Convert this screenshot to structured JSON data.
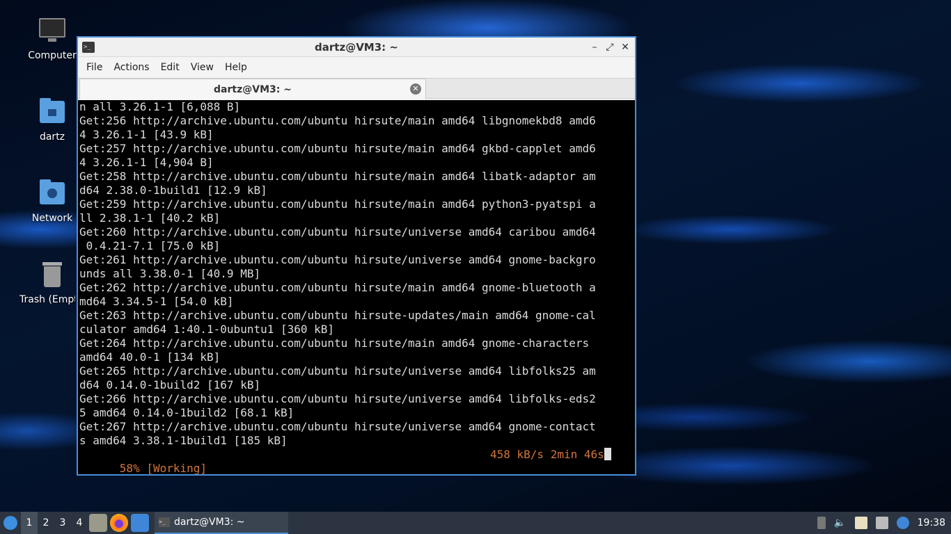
{
  "desktop": {
    "icons": [
      {
        "label": "Computer"
      },
      {
        "label": "dartz"
      },
      {
        "label": "Network"
      },
      {
        "label": "Trash (Empty)"
      }
    ]
  },
  "window": {
    "title": "dartz@VM3: ~",
    "menu": [
      "File",
      "Actions",
      "Edit",
      "View",
      "Help"
    ],
    "tab_label": "dartz@VM3: ~"
  },
  "terminal": {
    "lines": [
      "n all 3.26.1-1 [6,088 B]",
      "Get:256 http://archive.ubuntu.com/ubuntu hirsute/main amd64 libgnomekbd8 amd6",
      "4 3.26.1-1 [43.9 kB]",
      "Get:257 http://archive.ubuntu.com/ubuntu hirsute/main amd64 gkbd-capplet amd6",
      "4 3.26.1-1 [4,904 B]",
      "Get:258 http://archive.ubuntu.com/ubuntu hirsute/main amd64 libatk-adaptor am",
      "d64 2.38.0-1build1 [12.9 kB]",
      "Get:259 http://archive.ubuntu.com/ubuntu hirsute/main amd64 python3-pyatspi a",
      "ll 2.38.1-1 [40.2 kB]",
      "Get:260 http://archive.ubuntu.com/ubuntu hirsute/universe amd64 caribou amd64",
      " 0.4.21-7.1 [75.0 kB]",
      "Get:261 http://archive.ubuntu.com/ubuntu hirsute/universe amd64 gnome-backgro",
      "unds all 3.38.0-1 [40.9 MB]",
      "Get:262 http://archive.ubuntu.com/ubuntu hirsute/main amd64 gnome-bluetooth a",
      "md64 3.34.5-1 [54.0 kB]",
      "Get:263 http://archive.ubuntu.com/ubuntu hirsute-updates/main amd64 gnome-cal",
      "culator amd64 1:40.1-0ubuntu1 [360 kB]",
      "Get:264 http://archive.ubuntu.com/ubuntu hirsute/main amd64 gnome-characters",
      "amd64 40.0-1 [134 kB]",
      "Get:265 http://archive.ubuntu.com/ubuntu hirsute/universe amd64 libfolks25 am",
      "d64 0.14.0-1build2 [167 kB]",
      "Get:266 http://archive.ubuntu.com/ubuntu hirsute/universe amd64 libfolks-eds2",
      "5 amd64 0.14.0-1build2 [68.1 kB]",
      "Get:267 http://archive.ubuntu.com/ubuntu hirsute/universe amd64 gnome-contact",
      "s amd64 3.38.1-1build1 [185 kB]"
    ],
    "status_left": "58% [Working]",
    "status_right": "458 kB/s 2min 46s",
    "status_color": "#d4753a"
  },
  "taskbar": {
    "workspaces": [
      "1",
      "2",
      "3",
      "4"
    ],
    "active_task": "dartz@VM3: ~",
    "clock": "19:38"
  },
  "colors": {
    "window_border": "#4a8fd8",
    "taskbar_bg": "#2b3440"
  }
}
